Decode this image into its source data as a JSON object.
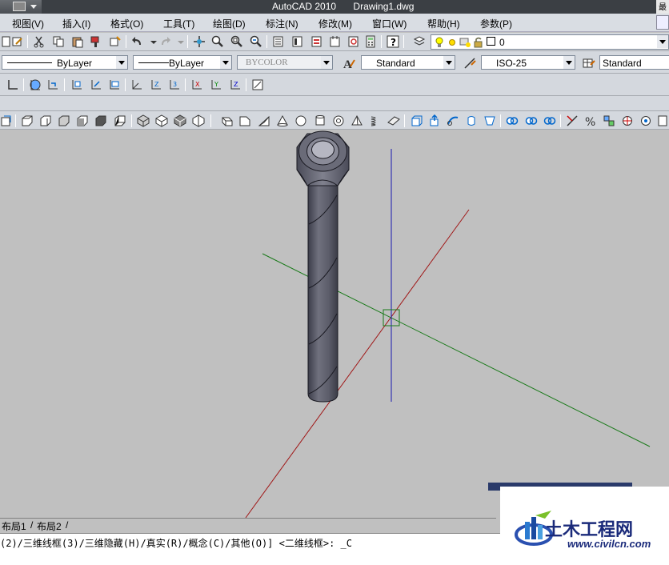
{
  "titlebar": {
    "app_name": "AutoCAD 2010",
    "document": "Drawing1.dwg",
    "corner_label": "最"
  },
  "menubar": {
    "items": [
      "视图(V)",
      "插入(I)",
      "格式(O)",
      "工具(T)",
      "绘图(D)",
      "标注(N)",
      "修改(M)",
      "窗口(W)",
      "帮助(H)",
      "参数(P)"
    ]
  },
  "properties_toolbar": {
    "linetype": "ByLayer",
    "lineweight": "ByLayer",
    "plotstyle": "BYCOLOR",
    "text_style": "Standard",
    "dim_style": "ISO-25",
    "table_style": "Standard",
    "layer": "0"
  },
  "layout_tabs": [
    "布局1",
    "布局2"
  ],
  "command_line": "(2)/三维线框(3)/三维隐藏(H)/真实(R)/概念(C)/其他(O)] <二维线框>: _C",
  "watermark": {
    "name": "土木工程网",
    "url": "www.civilcn.com"
  },
  "colors": {
    "viewport_bg": "#c0c0c0",
    "axis_x": "#a01818",
    "axis_y": "#1a7a1a",
    "axis_z": "#1a1ab0",
    "bolt": "#5a5b68"
  }
}
